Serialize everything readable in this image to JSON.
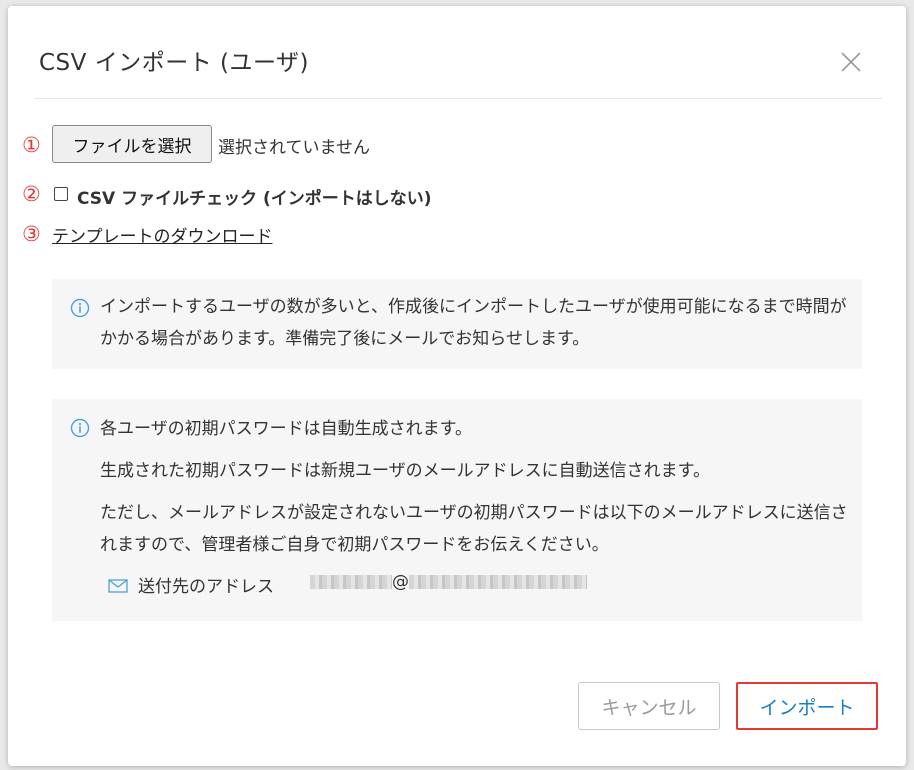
{
  "dialog": {
    "title": "CSV インポート (ユーザ)"
  },
  "steps": {
    "step1_number": "①",
    "file_button_label": "ファイルを選択",
    "file_status": "選択されていません",
    "step2_number": "②",
    "check_label": "CSV ファイルチェック (インポートはしない)",
    "check_checked": false,
    "step3_number": "③",
    "template_link": "テンプレートのダウンロード"
  },
  "notice1": {
    "text": "インポートするユーザの数が多いと、作成後にインポートしたユーザが使用可能になるまで時間がかかる場合があります。準備完了後にメールでお知らせします。"
  },
  "notice2": {
    "line1": "各ユーザの初期パスワードは自動生成されます。",
    "line2": "生成された初期パスワードは新規ユーザのメールアドレスに自動送信されます。",
    "line3": "ただし、メールアドレスが設定されないユーザの初期パスワードは以下のメールアドレスに送信されますので、管理者様ご自身で初期パスワードをお伝えください。",
    "mail_label": "送付先のアドレス",
    "mail_at": "@"
  },
  "footer": {
    "cancel_label": "キャンセル",
    "import_label": "インポート"
  },
  "icons": {
    "close": "close-icon",
    "info": "info-icon",
    "mail": "envelope-icon"
  },
  "colors": {
    "step_number": "#e53935",
    "info_icon": "#4aa3d8",
    "import_text": "#1a7fc1",
    "highlight_border": "#e53935"
  }
}
